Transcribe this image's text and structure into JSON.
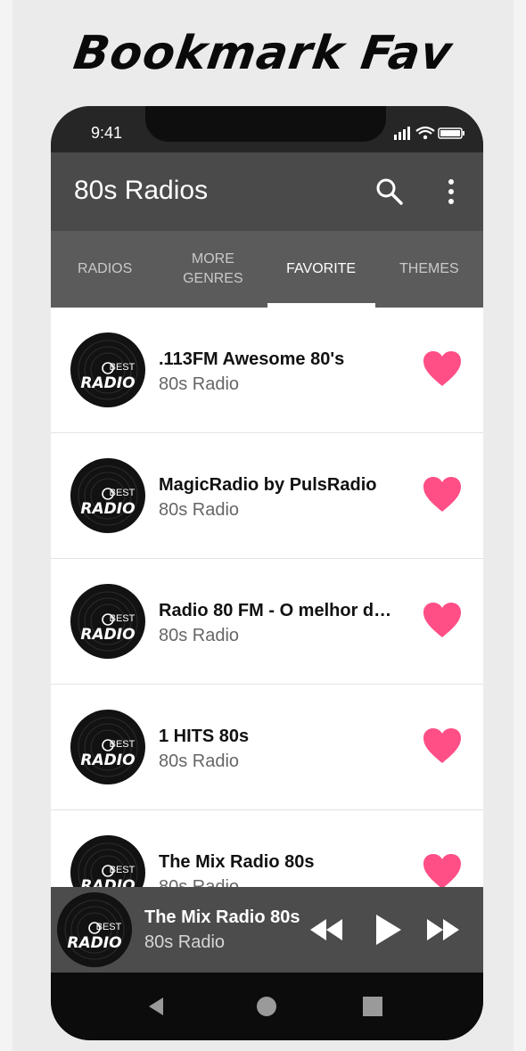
{
  "promo": {
    "headline": "Bookmark Fav"
  },
  "status": {
    "time": "9:41"
  },
  "appbar": {
    "title": "80s Radios",
    "search_icon": "search-icon",
    "menu_icon": "more-vert-icon"
  },
  "tabs": [
    {
      "label": "RADIOS",
      "active": false
    },
    {
      "label": "MORE GENRES",
      "active": false
    },
    {
      "label": "FAVORITE",
      "active": true
    },
    {
      "label": "THEMES",
      "active": false
    }
  ],
  "stations": [
    {
      "name": ".113FM Awesome 80's",
      "genre": "80s Radio",
      "favorite": true
    },
    {
      "name": "MagicRadio by PulsRadio",
      "genre": "80s Radio",
      "favorite": true
    },
    {
      "name": "Radio 80 FM - O melhor do...",
      "genre": "80s Radio",
      "favorite": true
    },
    {
      "name": "1 HITS 80s",
      "genre": "80s Radio",
      "favorite": true
    },
    {
      "name": "The Mix Radio 80s",
      "genre": "80s Radio",
      "favorite": true
    }
  ],
  "player": {
    "title": "The Mix Radio 80s",
    "subtitle": "80s Radio"
  },
  "logo": {
    "line1": "BEST",
    "line2": "RADIO"
  },
  "colors": {
    "heart": "#ff4f86",
    "appbar": "#4a4a4a",
    "tabs": "#5b5b5b",
    "player": "#4c4c4c"
  }
}
